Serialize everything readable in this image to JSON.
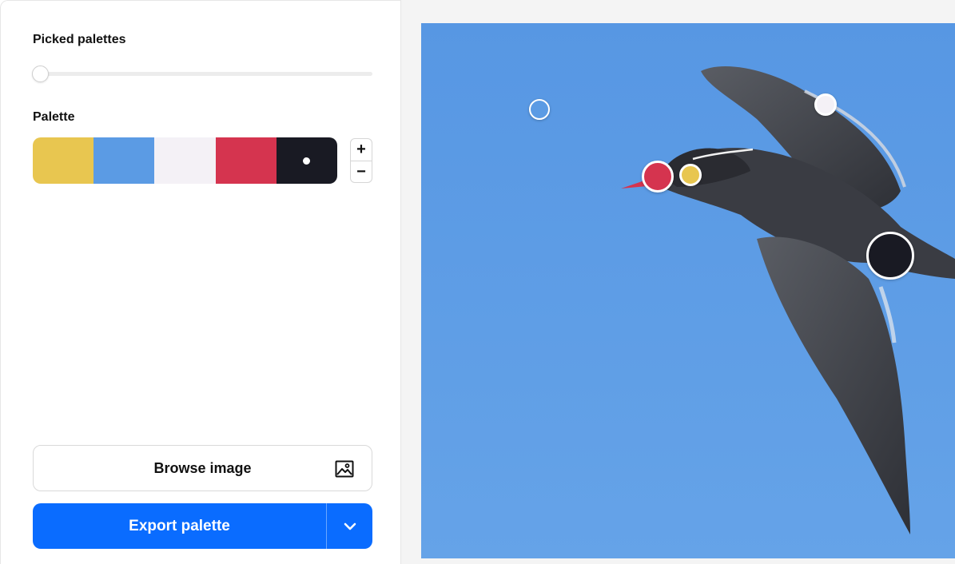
{
  "left_panel": {
    "picked_palettes_title": "Picked palettes",
    "slider": {
      "value": 0
    },
    "palette_title": "Palette",
    "palette": [
      {
        "name": "yellow",
        "hex": "#E8C650"
      },
      {
        "name": "blue",
        "hex": "#5B9BE4"
      },
      {
        "name": "off-white",
        "hex": "#F4F1F6"
      },
      {
        "name": "red",
        "hex": "#D5344F"
      },
      {
        "name": "dark",
        "hex": "#191A23"
      }
    ],
    "selected_swatch_index": 4,
    "stepper": {
      "plus_label": "+",
      "minus_label": "−"
    },
    "browse_button": {
      "label": "Browse image",
      "icon": "image-icon"
    },
    "export_button": {
      "label": "Export palette",
      "dropdown_icon": "chevron-down-icon"
    }
  },
  "image": {
    "subject": "bird in flight against blue sky",
    "sky_color": "#5B9BE4"
  },
  "pickers": [
    {
      "color": "#5B9BE4",
      "name": "picker-blue"
    },
    {
      "color": "#F4F1F6",
      "name": "picker-white"
    },
    {
      "color": "#D5344F",
      "name": "picker-red"
    },
    {
      "color": "#E8C650",
      "name": "picker-yellow"
    },
    {
      "color": "#191A23",
      "name": "picker-dark"
    }
  ],
  "colors": {
    "accent": "#0A6CFF",
    "border": "#D9D9D9"
  }
}
